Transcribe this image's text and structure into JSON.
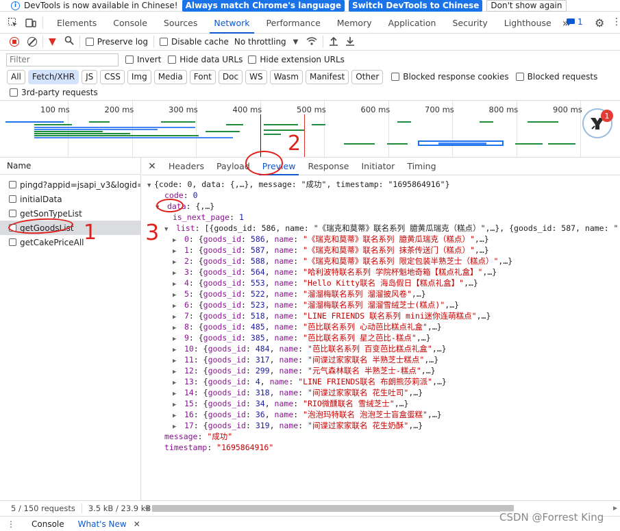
{
  "infobar": {
    "message": "DevTools is now available in Chinese!",
    "match_language": "Always match Chrome's language",
    "switch_chinese": "Switch DevTools to Chinese",
    "dont_show": "Don't show again"
  },
  "main_tabs": [
    "Elements",
    "Console",
    "Sources",
    "Network",
    "Performance",
    "Memory",
    "Application",
    "Security",
    "Lighthouse"
  ],
  "active_main_tab": "Network",
  "issues_count": "1",
  "toolbar": {
    "preserve_log": "Preserve log",
    "disable_cache": "Disable cache",
    "throttling": "No throttling"
  },
  "filter": {
    "placeholder": "Filter",
    "invert": "Invert",
    "hide_data_urls": "Hide data URLs",
    "hide_extension_urls": "Hide extension URLs"
  },
  "type_filters": [
    "All",
    "Fetch/XHR",
    "JS",
    "CSS",
    "Img",
    "Media",
    "Font",
    "Doc",
    "WS",
    "Wasm",
    "Manifest",
    "Other"
  ],
  "active_type_filter": "Fetch/XHR",
  "blocked_response_cookies": "Blocked response cookies",
  "blocked_requests": "Blocked requests",
  "third_party": "3rd-party requests",
  "timeline_ticks": [
    "100 ms",
    "200 ms",
    "300 ms",
    "400 ms",
    "500 ms",
    "600 ms",
    "700 ms",
    "800 ms",
    "900 ms",
    "10"
  ],
  "avatar_badge": "1",
  "name_header": "Name",
  "requests": [
    "pingd?appid=jsapi_v3&logid=...",
    "initialData",
    "getSonTypeList",
    "getGoodsList",
    "getCakePriceAll"
  ],
  "selected_request": "getGoodsList",
  "detail_tabs": [
    "Headers",
    "Payload",
    "Preview",
    "Response",
    "Initiator",
    "Timing"
  ],
  "active_detail_tab": "Preview",
  "preview": {
    "root_summary": "{code: 0, data: {,…}, message: \"成功\", timestamp: \"1695864916\"}",
    "code_key": "code",
    "code_val": "0",
    "data_key": "data",
    "data_summary": "{,…}",
    "is_next_page_key": "is_next_page",
    "is_next_page_val": "1",
    "list_key": "list",
    "list_summary": "[{goods_id: 586, name: \"《瑞克和莫蒂》联名系列 臆黄瓜瑞克（糕点）\",…}, {goods_id: 587, name: \"《瑞",
    "items": [
      {
        "idx": "0",
        "id": "586",
        "name": "《瑞克和莫蒂》联名系列 臆黄瓜瑞克（糕点）"
      },
      {
        "idx": "1",
        "id": "587",
        "name": "《瑞克和莫蒂》联名系列 抹茶传送门（糕点）"
      },
      {
        "idx": "2",
        "id": "588",
        "name": "《瑞克和莫蒂》联名系列 限定包装半熟芝士（糕点）"
      },
      {
        "idx": "3",
        "id": "564",
        "name": "哈利波特联名系列 学院杯魁地奇箱【糕点礼盒】"
      },
      {
        "idx": "4",
        "id": "553",
        "name": "Hello Kitty联名 海岛假日【糕点礼盒】"
      },
      {
        "idx": "5",
        "id": "522",
        "name": "溜溜梅联名系列 溜溜披风卷"
      },
      {
        "idx": "6",
        "id": "523",
        "name": "溜溜梅联名系列 溜溜雪绒芝士(糕点)"
      },
      {
        "idx": "7",
        "id": "518",
        "name": "LINE FRIENDS 联名系列 mini迷你连萌糕点"
      },
      {
        "idx": "8",
        "id": "485",
        "name": "芭比联名系列 心动芭比糕点礼盒"
      },
      {
        "idx": "9",
        "id": "385",
        "name": "芭比联名系列 星之芭比-糕点"
      },
      {
        "idx": "10",
        "id": "484",
        "name": "芭比联名系列 百变芭比糕点礼盒"
      },
      {
        "idx": "11",
        "id": "317",
        "name": "间谍过家家联名 半熟芝士糕点"
      },
      {
        "idx": "12",
        "id": "299",
        "name": "元气森林联名 半熟芝士-糕点"
      },
      {
        "idx": "13",
        "id": "4",
        "name": "LINE FRIENDS联名 布朗熊莎莉派"
      },
      {
        "idx": "14",
        "id": "318",
        "name": "间谍过家家联名 花生吐司"
      },
      {
        "idx": "15",
        "id": "34",
        "name": "RIO微醺联名 雪绒芝士"
      },
      {
        "idx": "16",
        "id": "36",
        "name": "泡泡玛特联名 泡泡芝士盲盒蛋糕"
      },
      {
        "idx": "17",
        "id": "319",
        "name": "间谍过家家联名 花生奶酥"
      }
    ],
    "message_key": "message",
    "message_val": "\"成功\"",
    "timestamp_key": "timestamp",
    "timestamp_val": "\"1695864916\""
  },
  "status": {
    "requests": "5 / 150 requests",
    "transferred": "3.5 kB / 23.9 kB"
  },
  "drawer_tabs": [
    "Console",
    "What's New"
  ],
  "annotations": [
    "1",
    "2",
    "3"
  ],
  "watermark": "CSDN @Forrest King",
  "colors": {
    "accent": "#0b57d0",
    "annotation": "#e0201a",
    "json_key": "#881391",
    "json_string": "#c80000",
    "json_number": "#1a1aa6"
  }
}
